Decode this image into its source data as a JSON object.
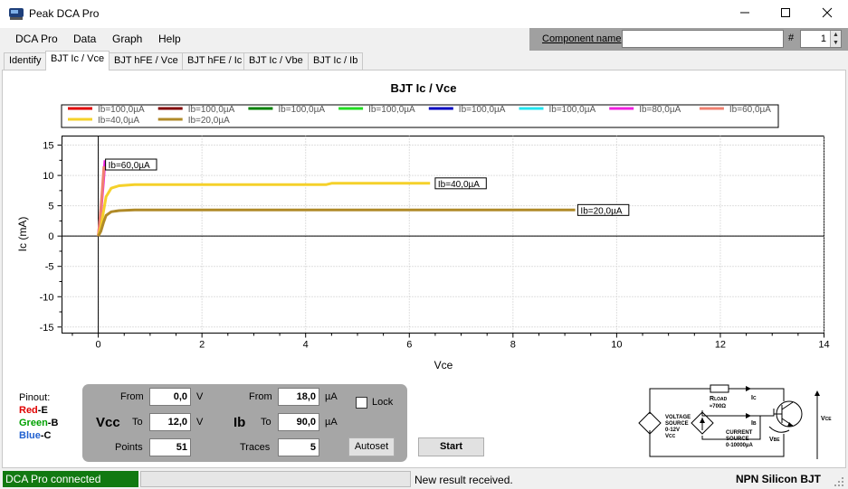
{
  "window": {
    "title": "Peak DCA Pro"
  },
  "menu": [
    "DCA Pro",
    "Data",
    "Graph",
    "Help"
  ],
  "component": {
    "label": "Component name",
    "value": "",
    "hash": "#",
    "number": "1"
  },
  "tabs": [
    "Identify",
    "BJT Ic / Vce",
    "BJT hFE / Vce",
    "BJT hFE / Ic",
    "BJT Ic / Vbe",
    "BJT Ic / Ib"
  ],
  "active_tab": 1,
  "chart_data": {
    "type": "line",
    "title": "BJT Ic / Vce",
    "xlabel": "Vce",
    "ylabel": "Ic (mA)",
    "xlim": [
      -0.7,
      14
    ],
    "ylim": [
      -16,
      16.5
    ],
    "xticks": [
      0,
      2,
      4,
      6,
      8,
      10,
      12,
      14
    ],
    "yticks": [
      -15,
      -10,
      -5,
      0,
      5,
      10,
      15
    ],
    "grid": true,
    "legend_position": "top",
    "series": [
      {
        "name": "Ib=100,0µA",
        "color": "#e00000",
        "x": [],
        "y": []
      },
      {
        "name": "Ib=100,0µA",
        "color": "#800000",
        "x": [],
        "y": []
      },
      {
        "name": "Ib=100,0µA",
        "color": "#008000",
        "x": [],
        "y": []
      },
      {
        "name": "Ib=100,0µA",
        "color": "#22dd22",
        "x": [],
        "y": []
      },
      {
        "name": "Ib=100,0µA",
        "color": "#0000c0",
        "x": [],
        "y": []
      },
      {
        "name": "Ib=100,0µA",
        "color": "#22e5f0",
        "x": [],
        "y": []
      },
      {
        "name": "Ib=80,0µA",
        "color": "#f020e0",
        "x": [
          0,
          0.05,
          0.1,
          0.13
        ],
        "y": [
          0,
          4,
          9,
          12.5
        ]
      },
      {
        "name": "Ib=60,0µA",
        "color": "#f08070",
        "x": [
          0,
          0.04,
          0.08,
          0.11
        ],
        "y": [
          0,
          3.5,
          8,
          11.5
        ]
      },
      {
        "name": "Ib=40,0µA",
        "color": "#f5d12a",
        "x": [
          0,
          0.05,
          0.1,
          0.15,
          0.25,
          0.4,
          0.7,
          1.5,
          3,
          4.4,
          4.5,
          6.4
        ],
        "y": [
          0,
          1.5,
          4,
          6.5,
          7.9,
          8.3,
          8.5,
          8.5,
          8.5,
          8.5,
          8.7,
          8.7
        ]
      },
      {
        "name": "Ib=20,0µA",
        "color": "#b08a28",
        "x": [
          0,
          0.05,
          0.1,
          0.15,
          0.25,
          0.4,
          0.7,
          1.5,
          3,
          6,
          9.2
        ],
        "y": [
          0,
          0.8,
          2.2,
          3.4,
          4.0,
          4.2,
          4.3,
          4.3,
          4.3,
          4.3,
          4.3
        ]
      }
    ],
    "annotations": [
      {
        "text": "Ib=60,0µA",
        "x": 0.14,
        "y": 11.8
      },
      {
        "text": "Ib=40,0µA",
        "x": 6.5,
        "y": 8.7
      },
      {
        "text": "Ib=20,0µA",
        "x": 9.25,
        "y": 4.3
      }
    ]
  },
  "pinout": {
    "label": "Pinout:",
    "red": "Red",
    "red_suffix": "-E",
    "green": "Green",
    "green_suffix": "-B",
    "blue": "Blue",
    "blue_suffix": "-C",
    "red_color": "#e00000",
    "green_color": "#00a000",
    "blue_color": "#2060d0"
  },
  "params": {
    "from_label": "From",
    "to_label": "To",
    "points_label": "Points",
    "traces_label": "Traces",
    "vcc_label": "Vcc",
    "vcc_from": "0,0",
    "vcc_to": "12,0",
    "vcc_unit": "V",
    "points": "51",
    "ib_label": "Ib",
    "ib_from": "18,0",
    "ib_to": "90,0",
    "ib_unit": "µA",
    "traces": "5",
    "lock_label": "Lock",
    "autoset_label": "Autoset"
  },
  "start_label": "Start",
  "circuit": {
    "rload_label": "R",
    "rload_sub": "LOAD",
    "rload_value": "≈700Ω",
    "ic_label": "I",
    "ic_sub": "C",
    "ib_label": "I",
    "ib_sub": "B",
    "vsrc_line1": "VOLTAGE",
    "vsrc_line2": "SOURCE",
    "vsrc_line3": "0-12V",
    "vsrc_line4": "V",
    "vsrc_line4_sub": "CC",
    "csrc_line1": "CURRENT",
    "csrc_line2": "SOURCE",
    "csrc_line3": "0-10000µA",
    "vbe_label": "V",
    "vbe_sub": "BE",
    "vce_label": "V",
    "vce_sub": "CE"
  },
  "status": {
    "connection": "DCA Pro connected",
    "message": "New result received.",
    "component_type": "NPN Silicon BJT",
    "connection_color": "#117911"
  }
}
